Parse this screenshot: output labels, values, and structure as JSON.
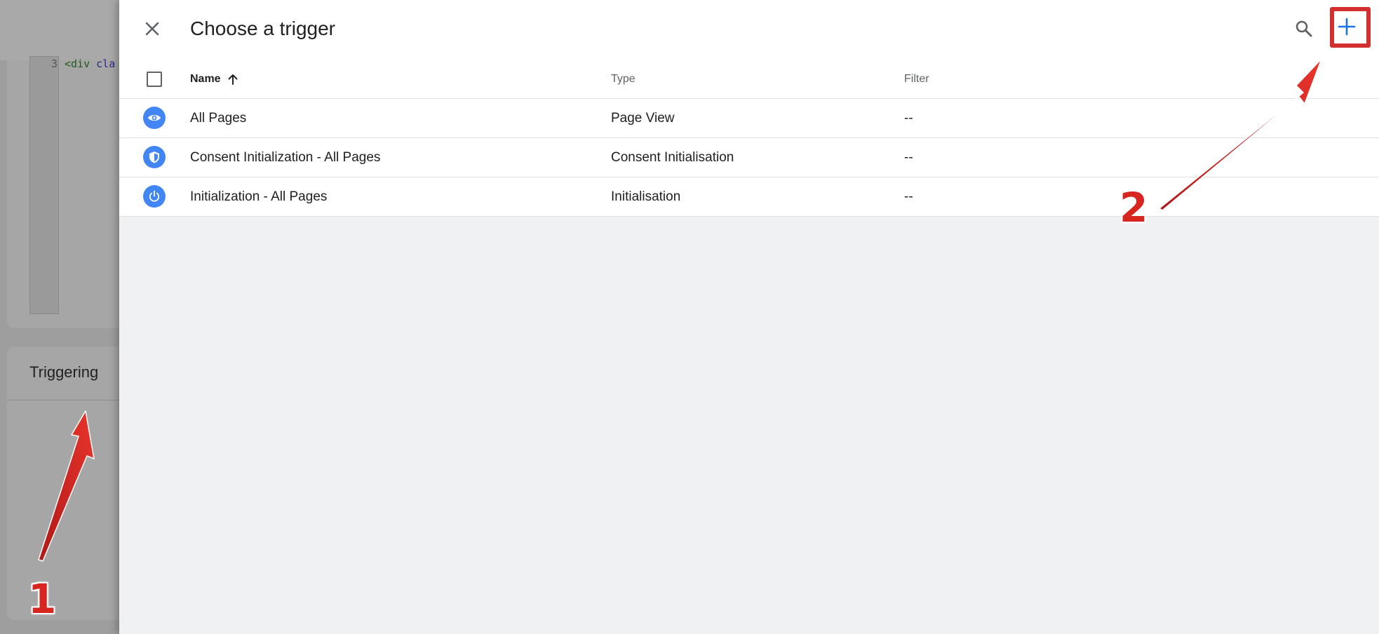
{
  "background": {
    "code_line_number": "3",
    "code_text_tag": "<div ",
    "code_text_attr": "cla",
    "triggering_title": "Triggering"
  },
  "panel": {
    "title": "Choose a trigger",
    "columns": {
      "name": "Name",
      "type": "Type",
      "filter": "Filter"
    },
    "rows": [
      {
        "name": "All Pages",
        "type": "Page View",
        "filter": "--",
        "icon": "eye-icon"
      },
      {
        "name": "Consent Initialization - All Pages",
        "type": "Consent Initialisation",
        "filter": "--",
        "icon": "shield-icon"
      },
      {
        "name": "Initialization - All Pages",
        "type": "Initialisation",
        "filter": "--",
        "icon": "power-icon"
      }
    ]
  },
  "annotations": {
    "step_1": "1",
    "step_2": "2"
  },
  "colors": {
    "accent_blue": "#4285f4",
    "annotation_red": "#d32f2f",
    "panel_bg": "#f0f1f3"
  }
}
